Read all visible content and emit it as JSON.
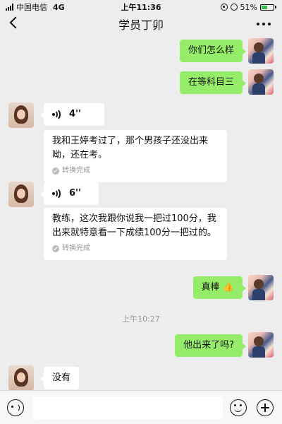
{
  "status_bar": {
    "carrier": "中国电信",
    "network": "4G",
    "time": "上午11:36",
    "battery": "51%",
    "battery_level": 0.51,
    "battery_color": "#2fbf4a"
  },
  "nav": {
    "title": "学员丁卯",
    "back_icon": "back-chevron-icon",
    "more_icon": "more-dots-icon"
  },
  "messages": {
    "m1": {
      "text": "你们怎么样"
    },
    "m2": {
      "text": "在等科目三"
    },
    "v1": {
      "duration": "4''",
      "transcript": "我和王婷考过了，那个男孩子还没出来呦，还在考。",
      "status": "转换完成"
    },
    "v2": {
      "duration": "6''",
      "transcript": "教练，这次我跟你说我一把过100分，我出来就特意看一下成绩100分一把过的。",
      "status": "转换完成"
    },
    "m3": {
      "text": "真棒",
      "emoji": "👍"
    },
    "timestamp": "上午10:27",
    "m4": {
      "text": "他出来了吗?"
    },
    "m5": {
      "text": "没有"
    }
  },
  "colors": {
    "background": "#ededed",
    "mine_bubble": "#95ec69",
    "theirs_bubble": "#ffffff"
  }
}
